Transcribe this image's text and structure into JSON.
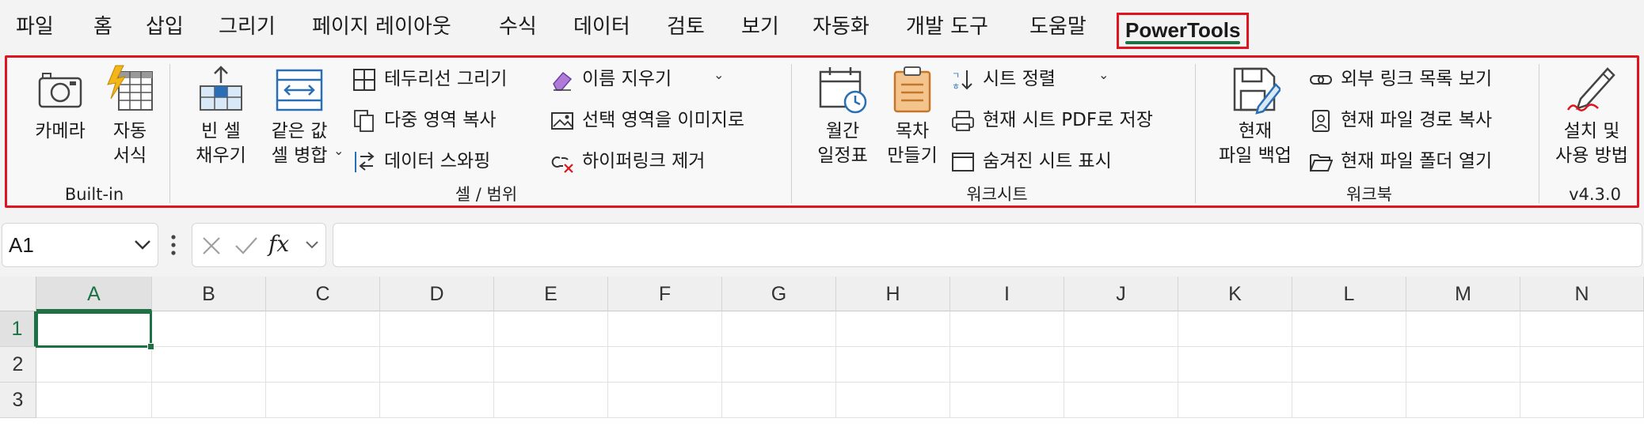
{
  "menu": {
    "items": [
      "파일",
      "홈",
      "삽입",
      "그리기",
      "페이지 레이아웃",
      "수식",
      "데이터",
      "검토",
      "보기",
      "자동화",
      "개발 도구",
      "도움말"
    ],
    "active_tab": "PowerTools"
  },
  "ribbon": {
    "builtin": {
      "label": "Built-in",
      "camera": "카메라",
      "autoformat": "자동\n서식"
    },
    "cells": {
      "label": "셀 / 범위",
      "fill_blank": "빈 셀\n채우기",
      "merge_same": "같은 값\n셀 병합",
      "draw_border": "테두리선 그리기",
      "multi_copy": "다중 영역 복사",
      "swap_data": "데이터 스와핑",
      "clear_names": "이름 지우기",
      "range_to_image": "선택 영역을 이미지로",
      "remove_links": "하이퍼링크 제거"
    },
    "sheets": {
      "label": "워크시트",
      "calendar": "월간\n일정표",
      "toc": "목차\n만들기",
      "sort_sheets": "시트 정렬",
      "save_pdf": "현재 시트 PDF로 저장",
      "show_hidden": "숨겨진 시트 표시"
    },
    "workbook": {
      "label": "워크북",
      "backup": "현재\n파일 백업",
      "ext_links": "외부 링크 목록 보기",
      "copy_path": "현재 파일 경로 복사",
      "open_folder": "현재 파일 폴더 열기"
    },
    "about": {
      "label": "v4.3.0",
      "install": "설치 및\n사용 방법"
    }
  },
  "formula_bar": {
    "name_box": "A1",
    "fx": "fx",
    "value": ""
  },
  "grid": {
    "columns": [
      "A",
      "B",
      "C",
      "D",
      "E",
      "F",
      "G",
      "H",
      "I",
      "J",
      "K",
      "L",
      "M",
      "N"
    ],
    "rows": [
      "1",
      "2",
      "3"
    ],
    "selected_col": "A",
    "selected_row": "1"
  },
  "colors": {
    "accent_green": "#1e7145",
    "highlight_red": "#e0141e",
    "icon_blue": "#2a6fb5",
    "icon_orange": "#e87c1e"
  }
}
